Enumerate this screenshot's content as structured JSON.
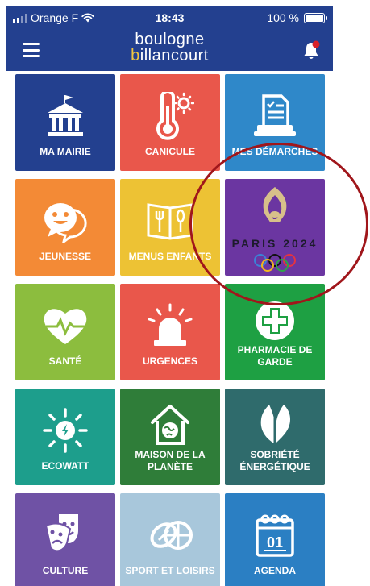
{
  "status_bar": {
    "carrier": "Orange F",
    "time": "18:43",
    "battery": "100 %"
  },
  "header": {
    "logo_line1": "boulogne",
    "logo_b": "b",
    "logo_rest": "illancourt"
  },
  "tiles": [
    {
      "label": "MA MAIRIE",
      "color": "#23408f",
      "icon": "town-hall-icon"
    },
    {
      "label": "CANICULE",
      "color": "#e9574b",
      "icon": "thermometer-sun-icon"
    },
    {
      "label": "MES DÉMARCHES",
      "color": "#2f88c9",
      "icon": "document-checklist-icon"
    },
    {
      "label": "JEUNESSE",
      "color": "#f38a36",
      "icon": "smiley-chat-icon"
    },
    {
      "label": "MENUS ENFANTS",
      "color": "#edc234",
      "icon": "menu-book-utensils-icon"
    },
    {
      "label": "PARIS 2024",
      "color": "#6b36a1",
      "icon": "paris-2024-logo-icon"
    },
    {
      "label": "SANTÉ",
      "color": "#8cbd3e",
      "icon": "heart-pulse-icon"
    },
    {
      "label": "URGENCES",
      "color": "#e9574b",
      "icon": "siren-icon"
    },
    {
      "label": "PHARMACIE DE GARDE",
      "color": "#1ea043",
      "icon": "pharmacy-cross-icon"
    },
    {
      "label": "ECOWATT",
      "color": "#1d9e8c",
      "icon": "ecowatt-sun-icon"
    },
    {
      "label": "MAISON DE LA PLANÈTE",
      "color": "#2f7d39",
      "icon": "house-planet-icon"
    },
    {
      "label": "SOBRIÉTÉ ÉNERGÉTIQUE",
      "color": "#2f6b6c",
      "icon": "leaf-icon"
    },
    {
      "label": "CULTURE",
      "color": "#6f52a5",
      "icon": "theater-masks-icon"
    },
    {
      "label": "SPORT ET LOISIRS",
      "color": "#a8c7db",
      "icon": "sport-balls-icon"
    },
    {
      "label": "AGENDA",
      "color": "#2b7fc3",
      "icon": "calendar-icon"
    }
  ],
  "calendar_day": "01",
  "accent": "#a0161b"
}
